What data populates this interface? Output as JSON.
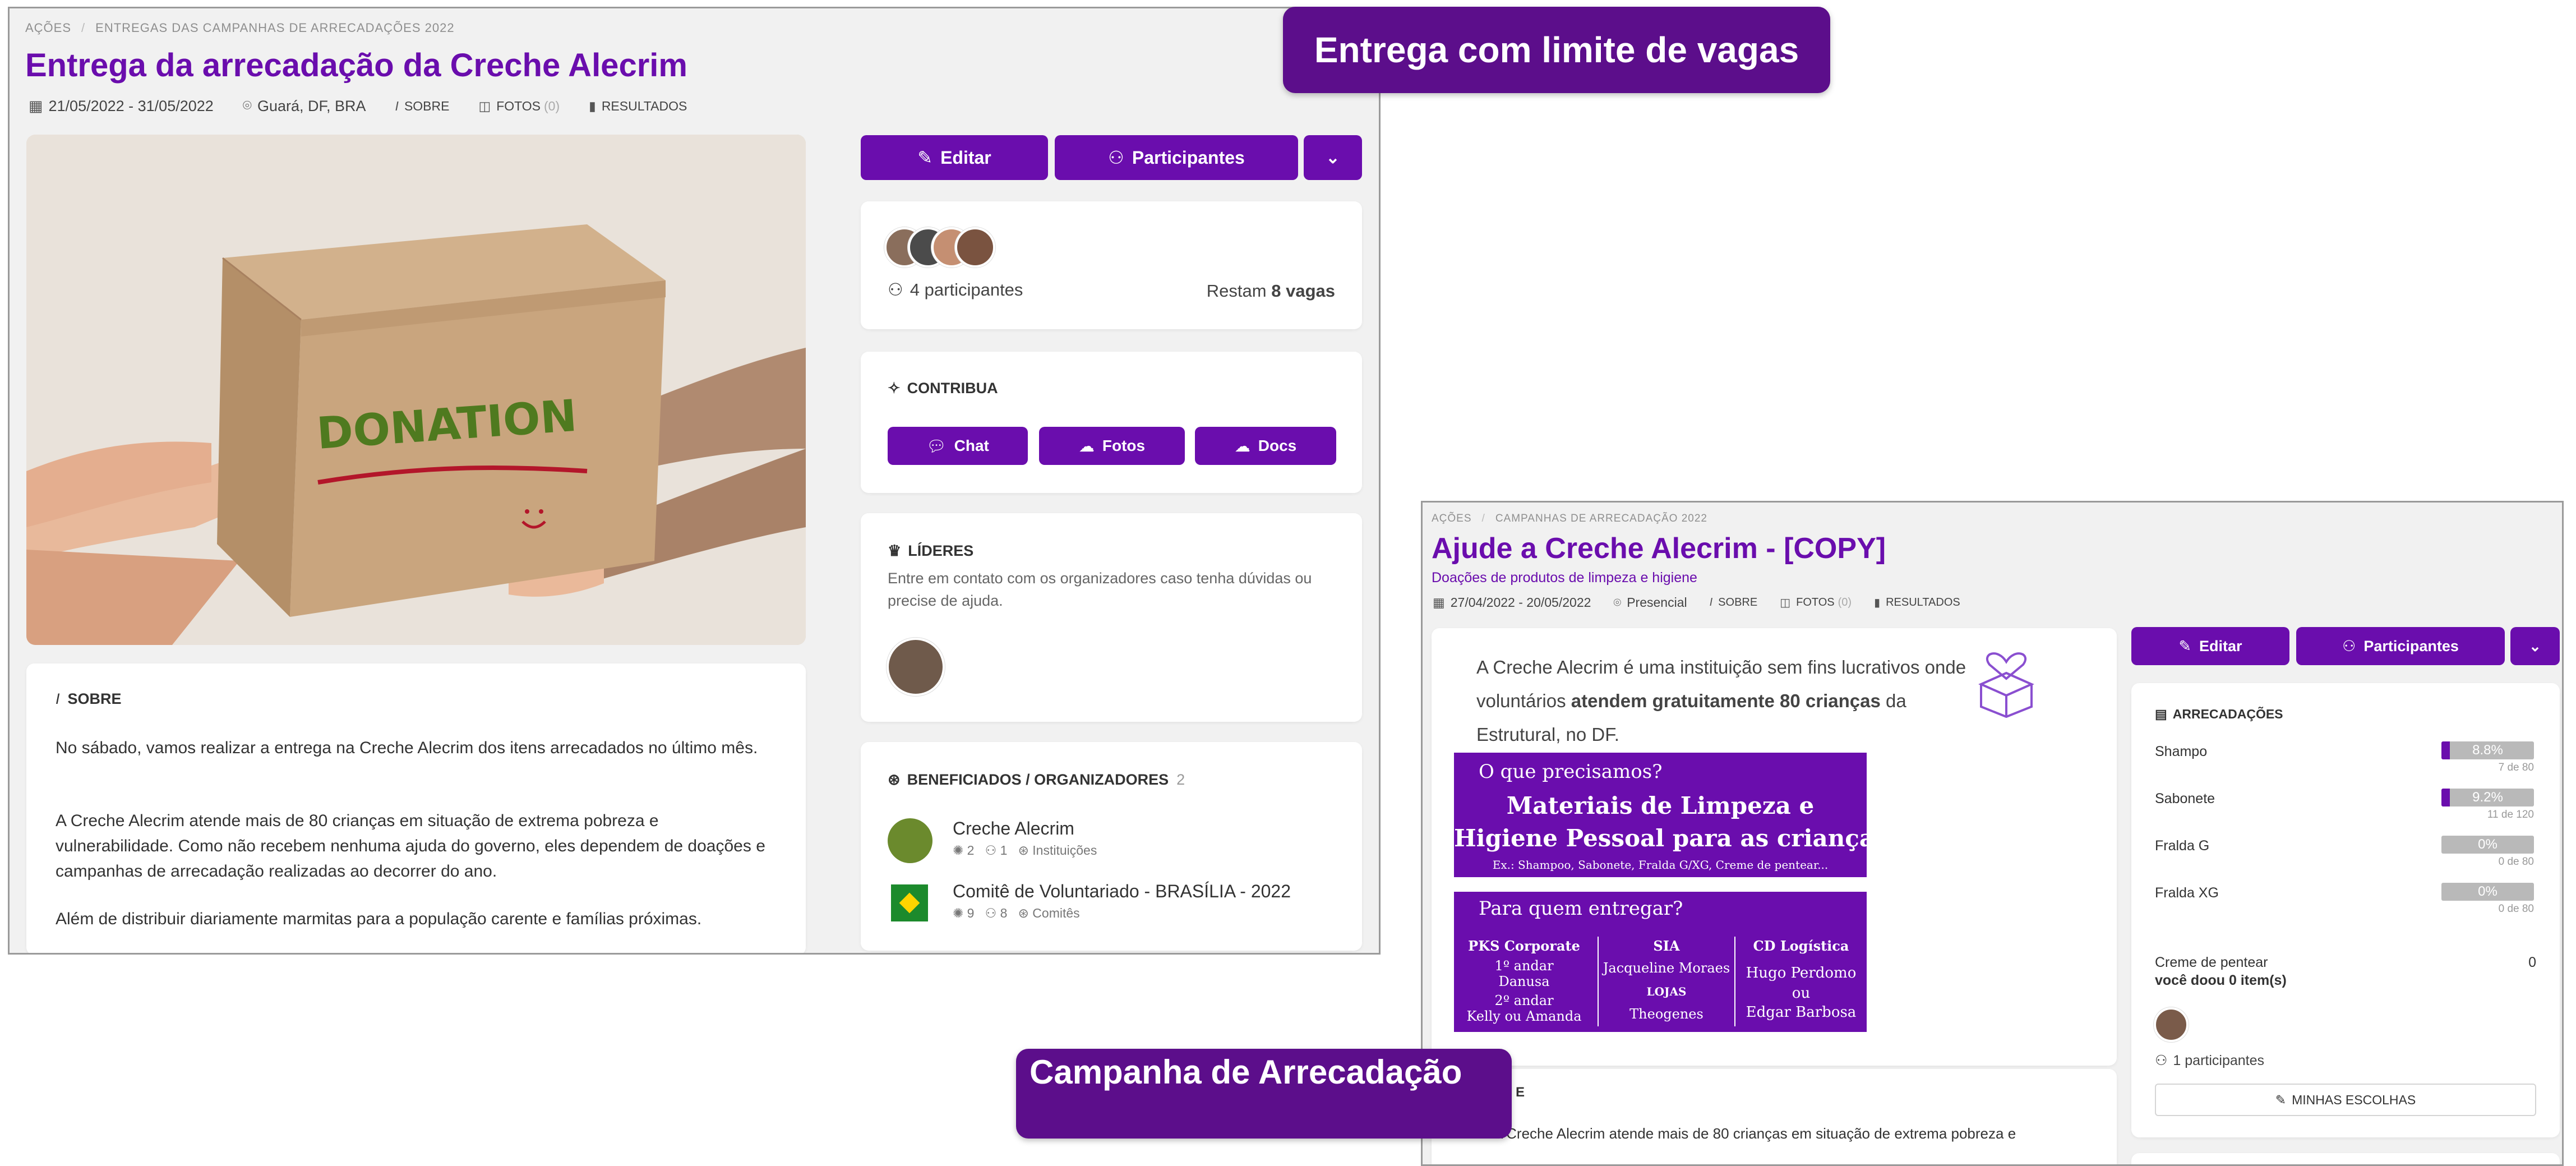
{
  "banners": {
    "top": "Entrega com limite de vagas",
    "bottom": "Campanha de Arrecadação"
  },
  "screen1": {
    "breadcrumb": [
      "AÇÕES",
      "ENTREGAS DAS CAMPANHAS DE ARRECADAÇÕES 2022"
    ],
    "title": "Entrega da arrecadação da Creche Alecrim",
    "meta": {
      "dates": "21/05/2022 - 31/05/2022",
      "location": "Guará, DF, BRA",
      "about": "SOBRE",
      "photos": "FOTOS",
      "photos_count": "(0)",
      "results": "RESULTADOS"
    },
    "photo_text": "DONATION",
    "buttons": {
      "edit": "Editar",
      "participants": "Participantes"
    },
    "participants": {
      "count_text": "4 participantes",
      "remaining_prefix": "Restam",
      "remaining_value": "8 vagas"
    },
    "contribute": {
      "title": "CONTRIBUA",
      "chat": "Chat",
      "photos": "Fotos",
      "docs": "Docs"
    },
    "leaders": {
      "title": "LÍDERES",
      "text": "Entre em contato com os organizadores caso tenha dúvidas ou precise de ajuda."
    },
    "beneficiaries": {
      "title": "BENEFICIADOS / ORGANIZADORES",
      "count": "2",
      "items": [
        {
          "name": "Creche Alecrim",
          "a": "2",
          "b": "1",
          "type": "Instituições"
        },
        {
          "name": "Comitê de Voluntariado - BRASÍLIA - 2022",
          "a": "9",
          "b": "8",
          "type": "Comitês"
        }
      ]
    },
    "about": {
      "title": "SOBRE",
      "p1": "No sábado, vamos realizar a entrega na Creche Alecrim dos itens arrecadados no último mês.",
      "p2": "A Creche Alecrim atende mais de 80 crianças em situação de extrema pobreza e vulnerabilidade. Como não recebem nenhuma ajuda do governo, eles dependem de doações e campanhas de arrecadação realizadas ao decorrer do ano.",
      "p3": "Além de distribuir diariamente marmitas para a população carente e famílias próximas."
    }
  },
  "screen2": {
    "breadcrumb": [
      "AÇÕES",
      "CAMPANHAS DE ARRECADAÇÃO 2022"
    ],
    "title": "Ajude a Creche Alecrim - [COPY]",
    "subtitle": "Doações de produtos de limpeza e higiene",
    "meta": {
      "dates": "27/04/2022 - 20/05/2022",
      "location": "Presencial",
      "about": "SOBRE",
      "photos": "FOTOS",
      "photos_count": "(0)",
      "results": "RESULTADOS"
    },
    "intro_a": "A Creche Alecrim é uma instituição sem fins lucrativos",
    "intro_b": "onde voluntários",
    "intro_bold": "atendem gratuitamente 80 crianças",
    "intro_c": "da Estrutural, no DF.",
    "poster1": {
      "q": "O que precisamos?",
      "h1": "Materiais de Limpeza e",
      "h2": "Higiene Pessoal para as crianças",
      "ex": "Ex.: Shampoo, Sabonete, Fralda G/XG, Creme de pentear..."
    },
    "poster2": {
      "q": "Para quem entregar?",
      "col1_h": "PKS Corporate",
      "col1_a": "1º andar",
      "col1_b": "Danusa",
      "col1_c": "2º andar",
      "col1_d": "Kelly ou Amanda",
      "col2_h": "SIA",
      "col2_a": "Jacqueline Moraes",
      "col2_b": "LOJAS",
      "col2_c": "Theogenes",
      "col3_h": "CD Logística",
      "col3_a": "Hugo Perdomo",
      "col3_b": "ou",
      "col3_c": "Edgar Barbosa"
    },
    "buttons": {
      "edit": "Editar",
      "participants": "Participantes"
    },
    "collections": {
      "title": "ARRECADAÇÕES",
      "items": [
        {
          "name": "Shampo",
          "pct": "8.8%",
          "fraction": 0.088,
          "sub": "7 de 80"
        },
        {
          "name": "Sabonete",
          "pct": "9.2%",
          "fraction": 0.092,
          "sub": "11 de 120"
        },
        {
          "name": "Fralda G",
          "pct": "0%",
          "fraction": 0,
          "sub": "0 de 80"
        },
        {
          "name": "Fralda XG",
          "pct": "0%",
          "fraction": 0,
          "sub": "0 de 80"
        }
      ],
      "extra_name": "Creme de pentear",
      "extra_value": "0",
      "donated": "você doou 0 item(s)",
      "participants_text": "1 participantes",
      "choices_button": "MINHAS ESCOLHAS"
    },
    "about": {
      "title_partial": "E",
      "text": "A Creche Alecrim atende mais de 80 crianças em situação de extrema pobreza e"
    }
  }
}
